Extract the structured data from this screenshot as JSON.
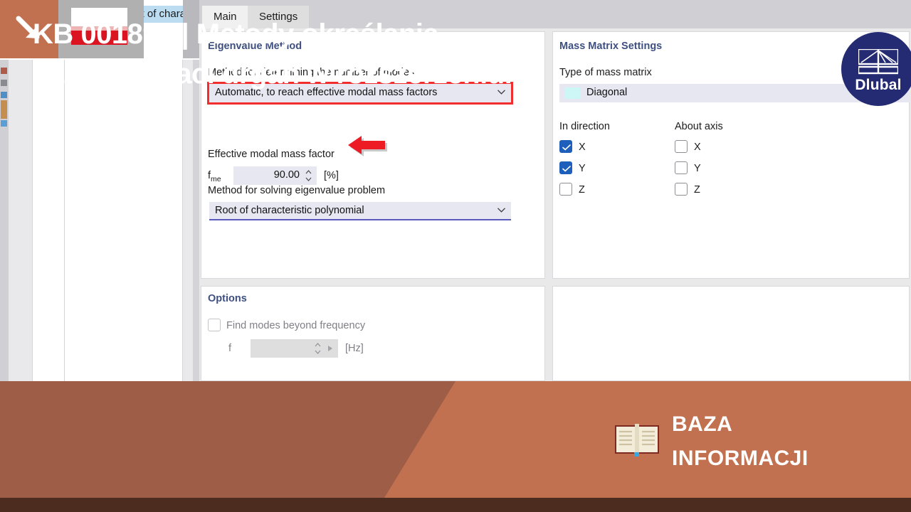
{
  "background_window": {
    "fragment_text": "Root of characteristic polynomial"
  },
  "dialog": {
    "tabs": [
      {
        "label": "Main",
        "active": true
      },
      {
        "label": "Settings",
        "active": false
      }
    ],
    "eigenvalue_method": {
      "group_title": "Eigenvalue Method",
      "method_modes_label": "Method for determining the number of modes",
      "method_modes_value": "Automatic, to reach effective modal mass factors",
      "effective_modal_mass_label": "Effective modal mass factor",
      "fme_symbol": "f",
      "fme_subscript": "me",
      "fme_value": "90.00",
      "fme_unit": "[%]",
      "solving_label": "Method for solving eigenvalue problem",
      "solving_value": "Root of characteristic polynomial"
    },
    "mass_matrix": {
      "group_title": "Mass Matrix Settings",
      "type_label": "Type of mass matrix",
      "type_value": "Diagonal",
      "swatch_color": "#cdf7f7",
      "in_direction_label": "In direction",
      "about_axis_label": "About axis",
      "in_direction": [
        {
          "label": "X",
          "checked": true
        },
        {
          "label": "Y",
          "checked": true
        },
        {
          "label": "Z",
          "checked": false
        }
      ],
      "about_axis": [
        {
          "label": "X",
          "checked": false
        },
        {
          "label": "Y",
          "checked": false
        },
        {
          "label": "Z",
          "checked": false
        }
      ]
    },
    "options": {
      "group_title": "Options",
      "find_modes_label": "Find modes beyond frequency",
      "find_modes_checked": false,
      "f_symbol": "f",
      "f_value": "",
      "f_unit": "[Hz]"
    }
  },
  "logo": {
    "wordmark": "Dlubal",
    "color": "#252b73"
  },
  "banner": {
    "title_line1": "KB 001891 | Metody określania",
    "title_line2": "liczby postaci drgań w rozszerzeniu...",
    "kb_line1": "BAZA",
    "kb_line2": "INFORMACJI",
    "bg_color": "#9e5d46",
    "accent_color": "#c1714f"
  }
}
